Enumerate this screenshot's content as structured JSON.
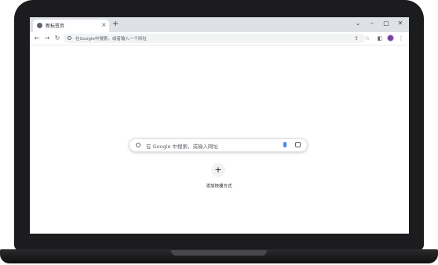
{
  "browser": {
    "tab": {
      "title": "新标签页",
      "close_glyph": "×"
    },
    "new_tab_glyph": "+",
    "window_controls": {
      "menu_glyph": "⌄",
      "minimize_glyph": "–",
      "maximize_glyph": "▢",
      "close_glyph": "✕"
    },
    "toolbar": {
      "back_glyph": "←",
      "forward_glyph": "→",
      "reload_glyph": "↻",
      "omnibox_placeholder": "在Google中搜索，或者输入一个网址",
      "share_glyph": "⇪",
      "bookmark_glyph": "☆",
      "side_panel_glyph": "◧",
      "menu_glyph": "⋮"
    }
  },
  "new_tab_page": {
    "search_placeholder": "在 Google 中搜索，或输入网址",
    "shortcut": {
      "icon_glyph": "+",
      "label": "添加快捷方式"
    }
  },
  "colors": {
    "tabstrip_bg": "#dee1e6",
    "omnibox_bg": "#f1f3f4",
    "accent_blue": "#4285f4",
    "avatar": "#7b3fa0",
    "bezel": "#1c1c1e"
  },
  "icons": [
    "chrome-favicon-icon",
    "search-icon",
    "microphone-icon",
    "google-lens-icon",
    "profile-avatar"
  ]
}
